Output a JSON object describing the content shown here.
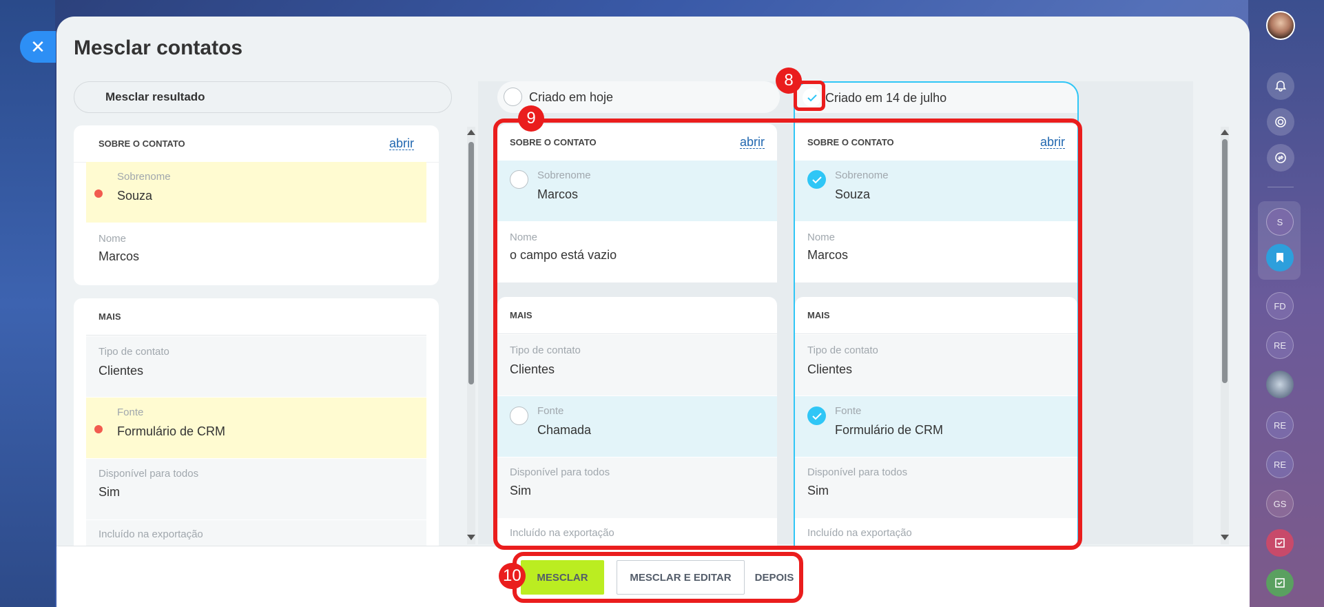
{
  "window": {
    "title": "Mesclar contatos"
  },
  "result": {
    "label": "Mesclar resultado",
    "about": {
      "heading": "SOBRE O CONTATO",
      "open": "abrir",
      "surname_label": "Sobrenome",
      "surname_value": "Souza",
      "name_label": "Nome",
      "name_value": "Marcos"
    },
    "more": {
      "heading": "MAIS",
      "type_label": "Tipo de contato",
      "type_value": "Clientes",
      "source_label": "Fonte",
      "source_value": "Formulário de CRM",
      "available_label": "Disponível para todos",
      "available_value": "Sim",
      "export_label": "Incluído na exportação"
    }
  },
  "versions": [
    {
      "pill": "Criado em hoje",
      "selected": false,
      "about": {
        "heading": "SOBRE O CONTATO",
        "open": "abrir",
        "surname_label": "Sobrenome",
        "surname_value": "Marcos",
        "name_label": "Nome",
        "name_value": "o campo está vazio"
      },
      "more": {
        "heading": "MAIS",
        "type_label": "Tipo de contato",
        "type_value": "Clientes",
        "source_label": "Fonte",
        "source_value": "Chamada",
        "available_label": "Disponível para todos",
        "available_value": "Sim",
        "export_label": "Incluído na exportação"
      }
    },
    {
      "pill": "Criado em 14 de julho",
      "selected": true,
      "about": {
        "heading": "SOBRE O CONTATO",
        "open": "abrir",
        "surname_label": "Sobrenome",
        "surname_value": "Souza",
        "name_label": "Nome",
        "name_value": "Marcos"
      },
      "more": {
        "heading": "MAIS",
        "type_label": "Tipo de contato",
        "type_value": "Clientes",
        "source_label": "Fonte",
        "source_value": "Formulário de CRM",
        "available_label": "Disponível para todos",
        "available_value": "Sim",
        "export_label": "Incluído na exportação"
      }
    }
  ],
  "annotations": {
    "step8": "8",
    "step9": "9",
    "step10": "10"
  },
  "footer": {
    "merge": "MESCLAR",
    "merge_edit": "MESCLAR E EDITAR",
    "later": "DEPOIS"
  },
  "right_bar": {
    "initials": [
      "S",
      "FD",
      "RE",
      "RE",
      "RE",
      "GS"
    ]
  },
  "colors": {
    "accent": "#2fc6f6",
    "highlight_yellow": "#fffbd1",
    "highlight_blue": "#e3f4f9",
    "merge_button": "#bbed21",
    "annotation_red": "#ea1d1d"
  }
}
